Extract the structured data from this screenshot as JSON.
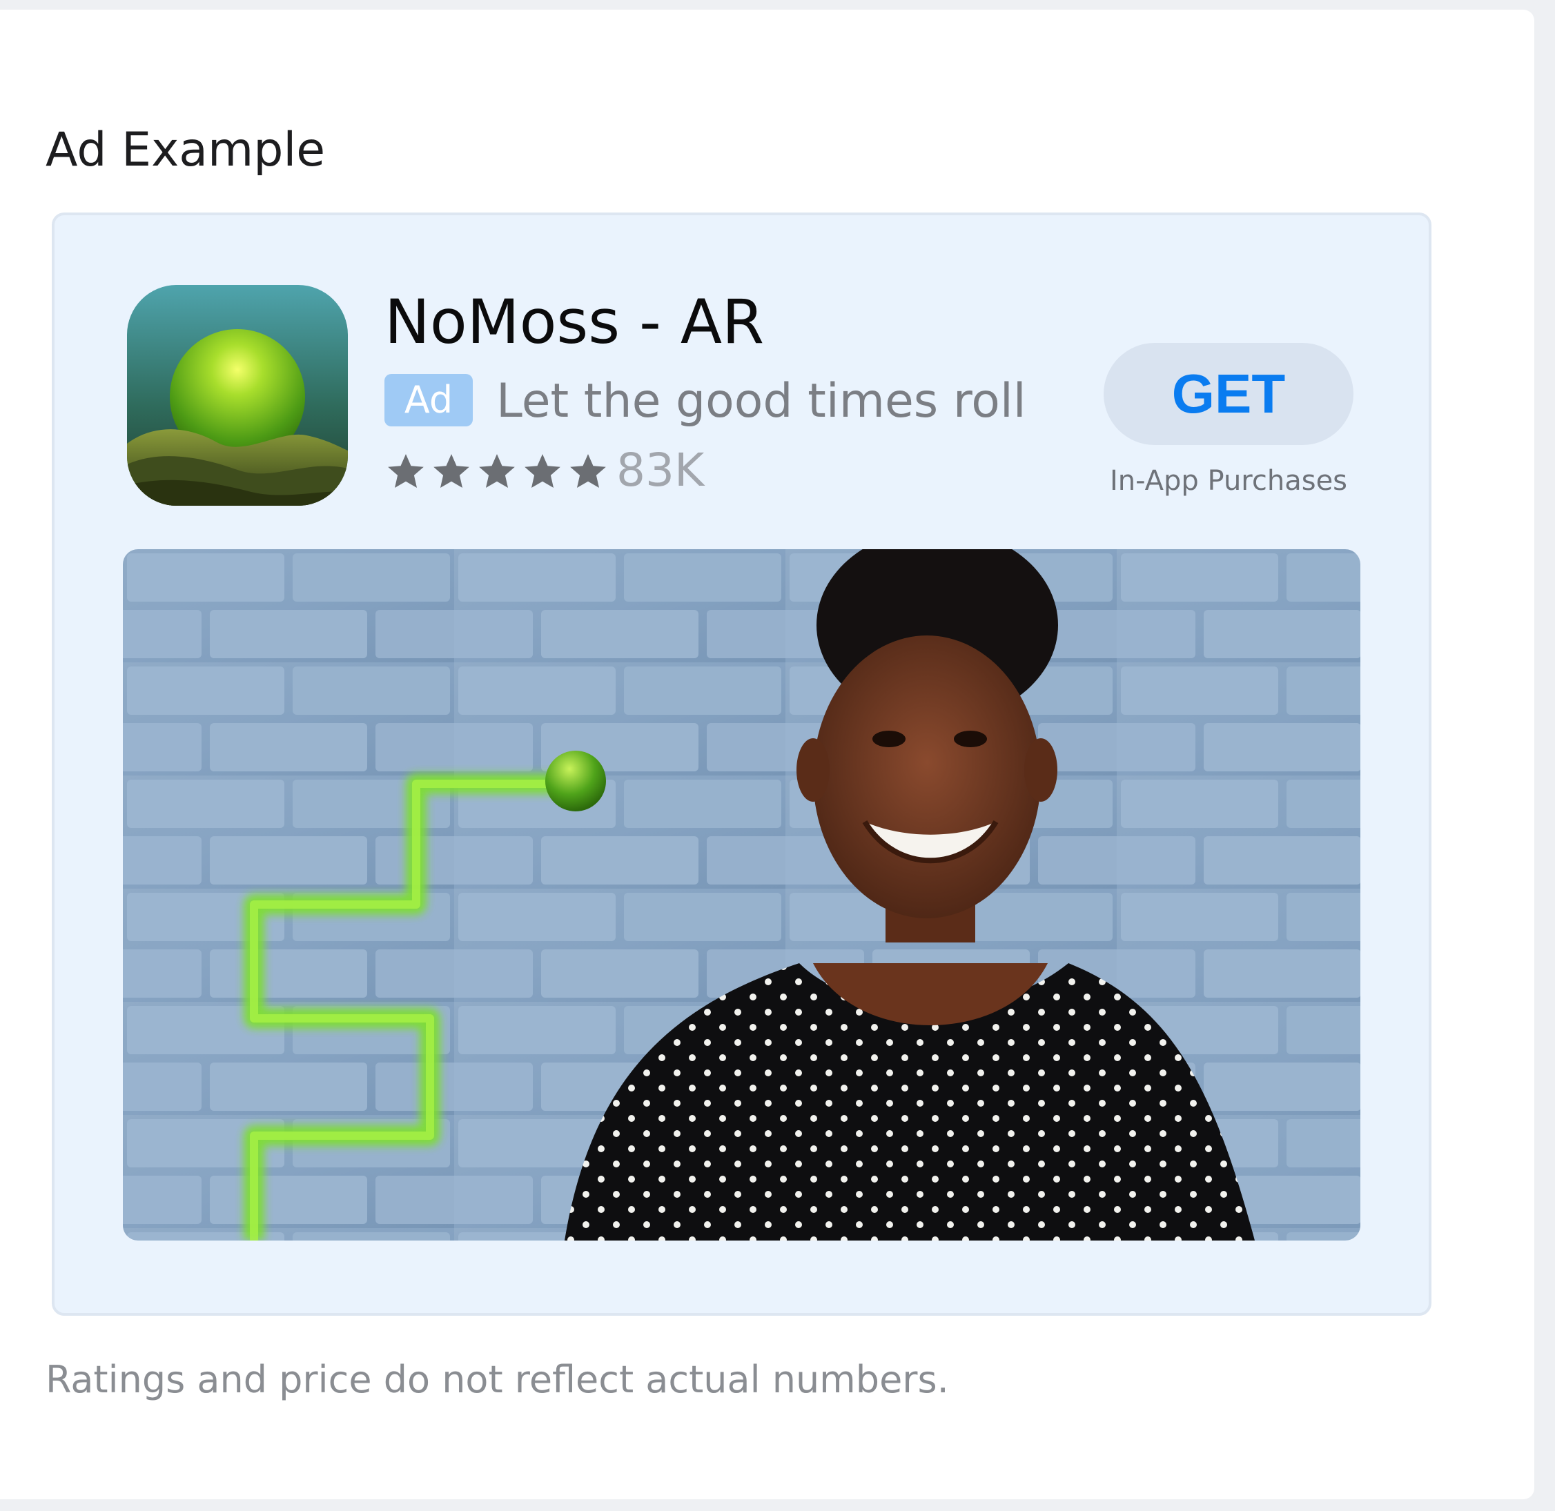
{
  "section": {
    "title": "Ad Example"
  },
  "ad": {
    "app_name": "NoMoss - AR",
    "badge_label": "Ad",
    "subtitle": "Let the good times roll",
    "rating": {
      "stars": 5,
      "count": "83K"
    },
    "get_label": "GET",
    "in_app_label": "In-App Purchases",
    "icon": "green-ball-app-icon",
    "image": "woman-brick-wall-green-path-photo"
  },
  "footer": {
    "disclaimer": "Ratings and price do not reflect actual numbers."
  },
  "colors": {
    "card_background": "#eaf3fd",
    "accent": "#0a7cf0",
    "badge": "#9fcaf5",
    "get_button_bg": "#d9e3f0"
  }
}
